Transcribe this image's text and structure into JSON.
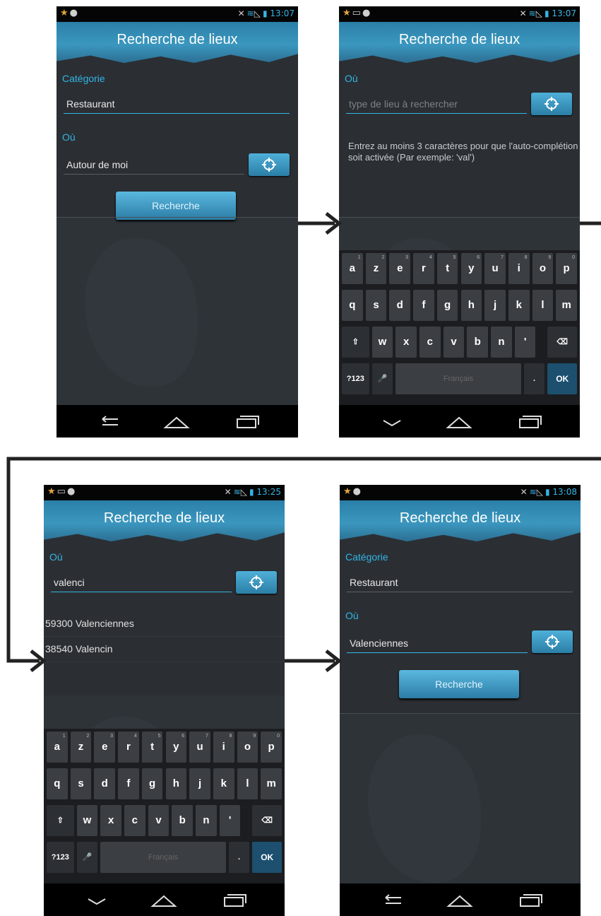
{
  "app": {
    "title": "Recherche de lieux"
  },
  "screen1": {
    "time": "13:07",
    "category_label": "Catégorie",
    "category_value": "Restaurant",
    "where_label": "Où",
    "where_value": "Autour de moi",
    "search_button": "Recherche"
  },
  "screen2": {
    "time": "13:07",
    "where_label": "Où",
    "where_placeholder": "type de lieu à rechercher",
    "hint": "Entrez au moins 3 caractères pour que l'auto-complétion soit activée (Par exemple: 'val')"
  },
  "screen3": {
    "time": "13:25",
    "where_label": "Où",
    "where_value": "valenci",
    "suggestions": [
      "59300  Valenciennes",
      "38540  Valencin"
    ]
  },
  "screen4": {
    "time": "13:08",
    "category_label": "Catégorie",
    "category_value": "Restaurant",
    "where_label": "Où",
    "where_value": "Valenciennes",
    "search_button": "Recherche"
  },
  "keyboard": {
    "row1": [
      {
        "k": "a",
        "s": "1"
      },
      {
        "k": "z",
        "s": "2"
      },
      {
        "k": "e",
        "s": "3"
      },
      {
        "k": "r",
        "s": "4"
      },
      {
        "k": "t",
        "s": "5"
      },
      {
        "k": "y",
        "s": "6"
      },
      {
        "k": "u",
        "s": "7"
      },
      {
        "k": "i",
        "s": "8"
      },
      {
        "k": "o",
        "s": "9"
      },
      {
        "k": "p",
        "s": "0"
      }
    ],
    "row2": [
      "q",
      "s",
      "d",
      "f",
      "g",
      "h",
      "j",
      "k",
      "l",
      "m"
    ],
    "row3": [
      "w",
      "x",
      "c",
      "v",
      "b",
      "n",
      "'"
    ],
    "shift": "⇧",
    "backspace": "⌫",
    "symbols": "?123",
    "mic": "🎤",
    "space": "Français",
    "period": ".",
    "ok": "OK"
  },
  "icons": {
    "star": "star-icon",
    "cat": "cat-icon",
    "keyboard": "keyboard-icon",
    "mute": "mute-icon",
    "wifi": "wifi-icon",
    "signal": "signal-icon",
    "battery": "battery-icon"
  }
}
